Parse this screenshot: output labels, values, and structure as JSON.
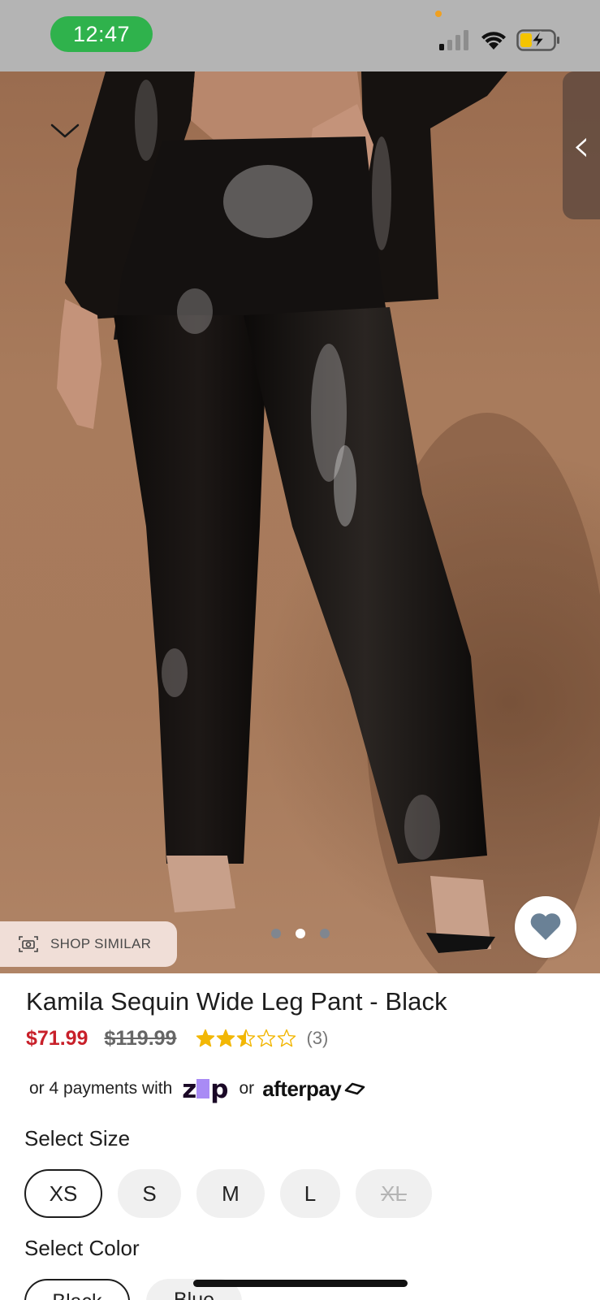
{
  "status_bar": {
    "time": "12:47",
    "signal_bars_active": 1,
    "signal_bars_total": 4,
    "battery_charging": true,
    "colors": {
      "time_pill": "#2fb24c",
      "bar": "#b4b4b4"
    }
  },
  "gallery": {
    "collapse_icon": "chevron-down-icon",
    "side_tab_glyph": "‹",
    "shop_similar_label": "SHOP SIMILAR",
    "shop_similar_icon": "camera-scan-icon",
    "favorite_icon": "heart-icon",
    "dots_count": 3,
    "active_dot": 2
  },
  "product": {
    "title": "Kamila Sequin Wide Leg Pant - Black",
    "sale_price": "$71.99",
    "original_price": "$119.99",
    "rating": 2.5,
    "rating_max": 5,
    "review_count": "(3)",
    "colors": {
      "sale": "#c8202a",
      "star": "#f2b705"
    }
  },
  "payment": {
    "prefix": "or 4 payments with",
    "zip_label": "zip",
    "or_label": "or",
    "afterpay_label": "afterpay"
  },
  "size_section": {
    "label": "Select Size",
    "options": [
      {
        "label": "XS",
        "state": "selected"
      },
      {
        "label": "S",
        "state": "available"
      },
      {
        "label": "M",
        "state": "available"
      },
      {
        "label": "L",
        "state": "available"
      },
      {
        "label": "XL",
        "state": "unavailable"
      }
    ]
  },
  "color_section": {
    "label": "Select Color",
    "options": [
      {
        "label": "Black",
        "state": "selected"
      },
      {
        "label": "Blue",
        "state": "available"
      }
    ]
  }
}
